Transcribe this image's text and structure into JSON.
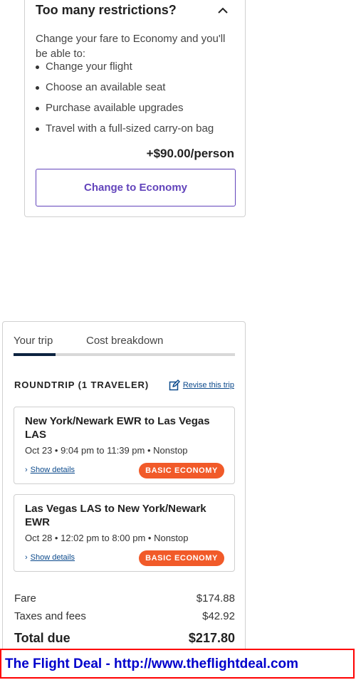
{
  "restrictions": {
    "title": "Too many restrictions?",
    "intro": "Change your fare to Economy and you'll be able to:",
    "benefits": [
      "Change your flight",
      "Choose an available seat",
      "Purchase available upgrades",
      "Travel with a full-sized carry-on bag"
    ],
    "price": "+$90.00/person",
    "button_label": "Change to Economy",
    "accent_color": "#6244bb",
    "icons": {
      "toggle": "chevron-up-icon"
    }
  },
  "trip": {
    "tabs": [
      {
        "label": "Your trip",
        "active": true
      },
      {
        "label": "Cost breakdown",
        "active": false
      }
    ],
    "heading": "ROUNDTRIP (1 TRAVELER)",
    "revise_label": "Revise this trip",
    "flights": [
      {
        "route": "New York/Newark EWR to Las Vegas LAS",
        "times": "Oct 23 • 9:04 pm to 11:39 pm • Nonstop",
        "details_label": "Show details",
        "fare_class": "BASIC ECONOMY"
      },
      {
        "route": "Las Vegas LAS to New York/Newark EWR",
        "times": "Oct 28 • 12:02 pm to 8:00 pm • Nonstop",
        "details_label": "Show details",
        "fare_class": "BASIC ECONOMY"
      }
    ],
    "costs": {
      "fare_label": "Fare",
      "fare_value": "$174.88",
      "taxes_label": "Taxes and fees",
      "taxes_value": "$42.92",
      "total_label": "Total due",
      "total_value": "$217.80"
    },
    "badge_color": "#f15a29",
    "link_color": "#0c4a8c",
    "icons": {
      "revise": "edit-icon",
      "details": "chevron-right-icon"
    }
  },
  "banner": {
    "text": "The Flight Deal - http://www.theflightdeal.com",
    "border_color": "#ff0000",
    "text_color": "#0000cc"
  }
}
